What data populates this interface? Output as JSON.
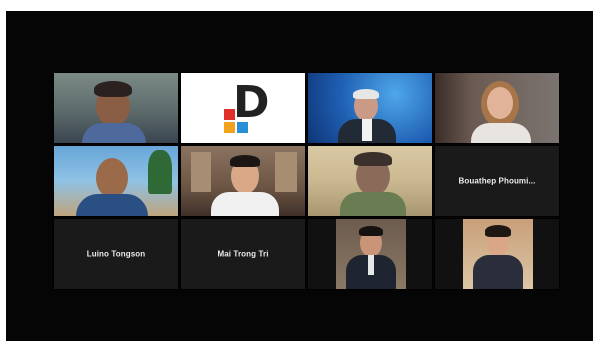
{
  "meeting": {
    "participants": [
      {
        "id": "p1",
        "name": "",
        "video": true
      },
      {
        "id": "p2",
        "name": "",
        "video": true,
        "logo": "D"
      },
      {
        "id": "p3",
        "name": "",
        "video": true
      },
      {
        "id": "p4",
        "name": "",
        "video": true
      },
      {
        "id": "p5",
        "name": "",
        "video": true
      },
      {
        "id": "p6",
        "name": "",
        "video": true
      },
      {
        "id": "p7",
        "name": "",
        "video": true
      },
      {
        "id": "p8",
        "name": "Bouathep  Phoumi...",
        "video": false
      },
      {
        "id": "p9",
        "name": "Luino Tongson",
        "video": false
      },
      {
        "id": "p10",
        "name": "Mai Trong Tri",
        "video": false
      },
      {
        "id": "p11",
        "name": "",
        "video": true
      },
      {
        "id": "p12",
        "name": "",
        "video": true
      }
    ]
  },
  "colors": {
    "background": "#050505",
    "tile_off": "#1a1a1a",
    "logo_red": "#e0302a",
    "logo_orange": "#f2a21b",
    "logo_blue": "#2a8ed6"
  }
}
